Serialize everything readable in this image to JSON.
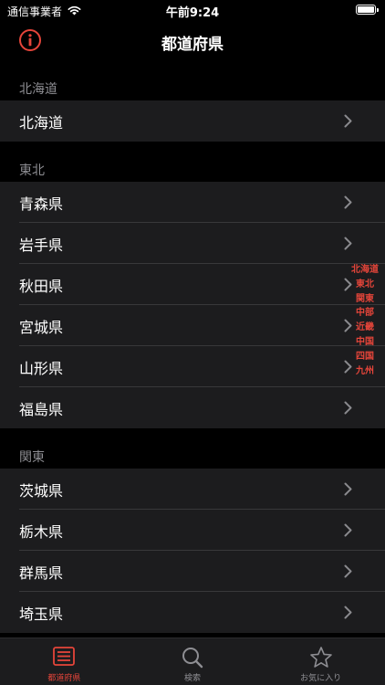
{
  "status_bar": {
    "carrier": "通信事業者",
    "time": "午前9:24",
    "battery_level": 1.0
  },
  "nav": {
    "title": "都道府県",
    "info_icon": "info-circle-icon"
  },
  "colors": {
    "accent": "#e5453a",
    "background": "#000000",
    "cell": "#1c1c1e",
    "secondary_text": "#8e8e93"
  },
  "sections": [
    {
      "header": "北海道",
      "items": [
        "北海道"
      ]
    },
    {
      "header": "東北",
      "items": [
        "青森県",
        "岩手県",
        "秋田県",
        "宮城県",
        "山形県",
        "福島県"
      ]
    },
    {
      "header": "関東",
      "items": [
        "茨城県",
        "栃木県",
        "群馬県",
        "埼玉県"
      ]
    }
  ],
  "section_index": [
    "北海道",
    "東北",
    "関東",
    "中部",
    "近畿",
    "中国",
    "四国",
    "九州"
  ],
  "tabs": [
    {
      "label": "都道府県",
      "icon": "list-icon",
      "active": true
    },
    {
      "label": "検索",
      "icon": "search-icon",
      "active": false
    },
    {
      "label": "お気に入り",
      "icon": "star-icon",
      "active": false
    }
  ]
}
